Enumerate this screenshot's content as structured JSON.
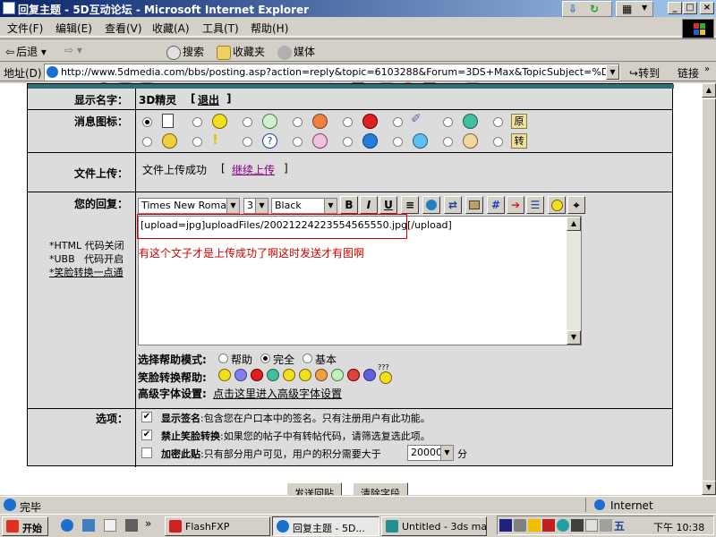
{
  "window": {
    "title": "回复主题 - 5D互动论坛 - Microsoft Internet Explorer",
    "controls": {
      "minimize": "_",
      "maximize": "□",
      "close": "×"
    }
  },
  "menu": [
    "文件(F)",
    "编辑(E)",
    "查看(V)",
    "收藏(A)",
    "工具(T)",
    "帮助(H)"
  ],
  "toolbar": {
    "back": "后退",
    "search": "搜索",
    "favorites": "收藏夹",
    "media": "媒体"
  },
  "address": {
    "label": "地址(D)",
    "url": "http://www.5dmedia.com/bbs/posting.asp?action=reply&topic=6103288&Forum=3DS+Max&TopicSubject=%D7%F7%C6%B7",
    "go": "转到",
    "links": "链接"
  },
  "form": {
    "display_name_label": "显示名字：",
    "display_name_value": "3D精灵",
    "logout": "退出",
    "logout_open": "[",
    "logout_close": "]",
    "icon_label": "消息图标：",
    "icon_yuan": "原",
    "icon_zhuan": "转",
    "upload_label": "文件上传：",
    "upload_status": "文件上传成功",
    "upload_open": "[",
    "upload_close": "]",
    "continue_upload": "继续上传",
    "reply_label": "您的回复：",
    "side_html": "*HTML 代码关闭",
    "side_ubb": "*UBB   代码开启",
    "side_smile": "*笑脸转换一点通",
    "font_select": "Times New Roman",
    "size_select": "3",
    "color_select": "Black",
    "btn_bold": "B",
    "btn_italic": "I",
    "btn_underline": "U",
    "btn_hash": "#",
    "textarea_value": "[upload=jpg]uploadFiles/20021224223554565550.jpg[/upload]",
    "annotation": "有这个文子才是上传成功了啊这时发送才有图啊",
    "help_mode_label": "选择帮助模式:",
    "help_mode_options": [
      "帮助",
      "完全",
      "基本"
    ],
    "help_mode_selected": "完全",
    "smile_help_label": "笑脸转换帮助:",
    "smile_question": "???",
    "advanced_font_label": "高级字体设置:",
    "advanced_font_link": "点击这里进入高级字体设置",
    "options_label": "选项：",
    "opt_signature_bold": "显示签名",
    "opt_signature_text": ":包含您在户口本中的签名。只有注册用户有此功能。",
    "opt_nosmile_bold": "禁止笑脸转换",
    "opt_nosmile_text": ":如果您的帖子中有转帖代码，请筛选复选此项。",
    "opt_encrypt_bold": "加密此贴",
    "opt_encrypt_text": ":只有部分用户可见，用户的积分需要大于",
    "encrypt_value": "20000",
    "encrypt_unit": "分",
    "submit": "发送回贴",
    "clear": "清除字段"
  },
  "status": {
    "text": "完毕",
    "zone": "Internet"
  },
  "taskbar": {
    "start": "开始",
    "tasks": [
      "FlashFXP",
      "回复主题 - 5D...",
      "Untitled - 3ds ma..."
    ],
    "tray_char": "五",
    "clock": "下午 10:38"
  },
  "colors": {
    "title_start": "#0a246a",
    "title_end": "#a6caf0",
    "form_header": "#2f7078",
    "annotation": "#d00000",
    "link": "#800080"
  }
}
